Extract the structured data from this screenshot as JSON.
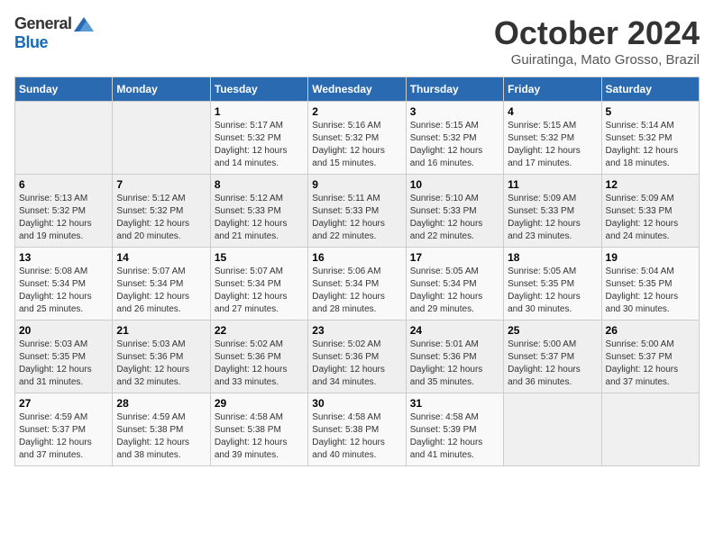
{
  "logo": {
    "general": "General",
    "blue": "Blue"
  },
  "title": "October 2024",
  "subtitle": "Guiratinga, Mato Grosso, Brazil",
  "days_of_week": [
    "Sunday",
    "Monday",
    "Tuesday",
    "Wednesday",
    "Thursday",
    "Friday",
    "Saturday"
  ],
  "weeks": [
    [
      {
        "day": "",
        "info": ""
      },
      {
        "day": "",
        "info": ""
      },
      {
        "day": "1",
        "info": "Sunrise: 5:17 AM\nSunset: 5:32 PM\nDaylight: 12 hours and 14 minutes."
      },
      {
        "day": "2",
        "info": "Sunrise: 5:16 AM\nSunset: 5:32 PM\nDaylight: 12 hours and 15 minutes."
      },
      {
        "day": "3",
        "info": "Sunrise: 5:15 AM\nSunset: 5:32 PM\nDaylight: 12 hours and 16 minutes."
      },
      {
        "day": "4",
        "info": "Sunrise: 5:15 AM\nSunset: 5:32 PM\nDaylight: 12 hours and 17 minutes."
      },
      {
        "day": "5",
        "info": "Sunrise: 5:14 AM\nSunset: 5:32 PM\nDaylight: 12 hours and 18 minutes."
      }
    ],
    [
      {
        "day": "6",
        "info": "Sunrise: 5:13 AM\nSunset: 5:32 PM\nDaylight: 12 hours and 19 minutes."
      },
      {
        "day": "7",
        "info": "Sunrise: 5:12 AM\nSunset: 5:32 PM\nDaylight: 12 hours and 20 minutes."
      },
      {
        "day": "8",
        "info": "Sunrise: 5:12 AM\nSunset: 5:33 PM\nDaylight: 12 hours and 21 minutes."
      },
      {
        "day": "9",
        "info": "Sunrise: 5:11 AM\nSunset: 5:33 PM\nDaylight: 12 hours and 22 minutes."
      },
      {
        "day": "10",
        "info": "Sunrise: 5:10 AM\nSunset: 5:33 PM\nDaylight: 12 hours and 22 minutes."
      },
      {
        "day": "11",
        "info": "Sunrise: 5:09 AM\nSunset: 5:33 PM\nDaylight: 12 hours and 23 minutes."
      },
      {
        "day": "12",
        "info": "Sunrise: 5:09 AM\nSunset: 5:33 PM\nDaylight: 12 hours and 24 minutes."
      }
    ],
    [
      {
        "day": "13",
        "info": "Sunrise: 5:08 AM\nSunset: 5:34 PM\nDaylight: 12 hours and 25 minutes."
      },
      {
        "day": "14",
        "info": "Sunrise: 5:07 AM\nSunset: 5:34 PM\nDaylight: 12 hours and 26 minutes."
      },
      {
        "day": "15",
        "info": "Sunrise: 5:07 AM\nSunset: 5:34 PM\nDaylight: 12 hours and 27 minutes."
      },
      {
        "day": "16",
        "info": "Sunrise: 5:06 AM\nSunset: 5:34 PM\nDaylight: 12 hours and 28 minutes."
      },
      {
        "day": "17",
        "info": "Sunrise: 5:05 AM\nSunset: 5:34 PM\nDaylight: 12 hours and 29 minutes."
      },
      {
        "day": "18",
        "info": "Sunrise: 5:05 AM\nSunset: 5:35 PM\nDaylight: 12 hours and 30 minutes."
      },
      {
        "day": "19",
        "info": "Sunrise: 5:04 AM\nSunset: 5:35 PM\nDaylight: 12 hours and 30 minutes."
      }
    ],
    [
      {
        "day": "20",
        "info": "Sunrise: 5:03 AM\nSunset: 5:35 PM\nDaylight: 12 hours and 31 minutes."
      },
      {
        "day": "21",
        "info": "Sunrise: 5:03 AM\nSunset: 5:36 PM\nDaylight: 12 hours and 32 minutes."
      },
      {
        "day": "22",
        "info": "Sunrise: 5:02 AM\nSunset: 5:36 PM\nDaylight: 12 hours and 33 minutes."
      },
      {
        "day": "23",
        "info": "Sunrise: 5:02 AM\nSunset: 5:36 PM\nDaylight: 12 hours and 34 minutes."
      },
      {
        "day": "24",
        "info": "Sunrise: 5:01 AM\nSunset: 5:36 PM\nDaylight: 12 hours and 35 minutes."
      },
      {
        "day": "25",
        "info": "Sunrise: 5:00 AM\nSunset: 5:37 PM\nDaylight: 12 hours and 36 minutes."
      },
      {
        "day": "26",
        "info": "Sunrise: 5:00 AM\nSunset: 5:37 PM\nDaylight: 12 hours and 37 minutes."
      }
    ],
    [
      {
        "day": "27",
        "info": "Sunrise: 4:59 AM\nSunset: 5:37 PM\nDaylight: 12 hours and 37 minutes."
      },
      {
        "day": "28",
        "info": "Sunrise: 4:59 AM\nSunset: 5:38 PM\nDaylight: 12 hours and 38 minutes."
      },
      {
        "day": "29",
        "info": "Sunrise: 4:58 AM\nSunset: 5:38 PM\nDaylight: 12 hours and 39 minutes."
      },
      {
        "day": "30",
        "info": "Sunrise: 4:58 AM\nSunset: 5:38 PM\nDaylight: 12 hours and 40 minutes."
      },
      {
        "day": "31",
        "info": "Sunrise: 4:58 AM\nSunset: 5:39 PM\nDaylight: 12 hours and 41 minutes."
      },
      {
        "day": "",
        "info": ""
      },
      {
        "day": "",
        "info": ""
      }
    ]
  ]
}
